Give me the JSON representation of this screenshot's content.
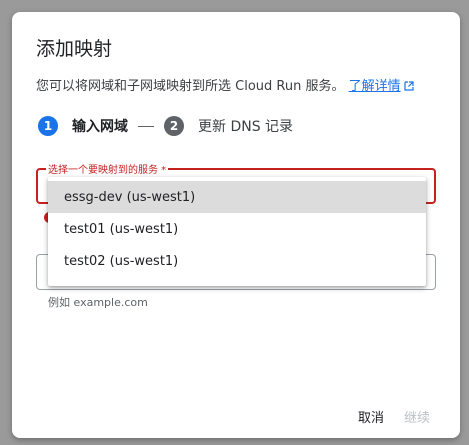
{
  "dialog": {
    "title": "添加映射",
    "description": "您可以将网域和子网域映射到所选 Cloud Run 服务。",
    "learn_more_label": "了解详情"
  },
  "stepper": {
    "steps": [
      {
        "number": "1",
        "label": "输入网域",
        "state": "active"
      },
      {
        "number": "2",
        "label": "更新 DNS 记录",
        "state": "inactive"
      }
    ]
  },
  "service_select": {
    "label": "选择一个要映射到的服务 *",
    "state": "error",
    "options": [
      {
        "label": "essg-dev (us-west1)",
        "highlighted": true
      },
      {
        "label": "test01 (us-west1)",
        "highlighted": false
      },
      {
        "label": "test02 (us-west1)",
        "highlighted": false
      }
    ]
  },
  "domain_input": {
    "hint": "例如 example.com"
  },
  "actions": {
    "cancel_label": "取消",
    "continue_label": "继续"
  },
  "colors": {
    "accent": "#1a73e8",
    "error": "#c5221f",
    "disabled": "#bdc1c6"
  }
}
